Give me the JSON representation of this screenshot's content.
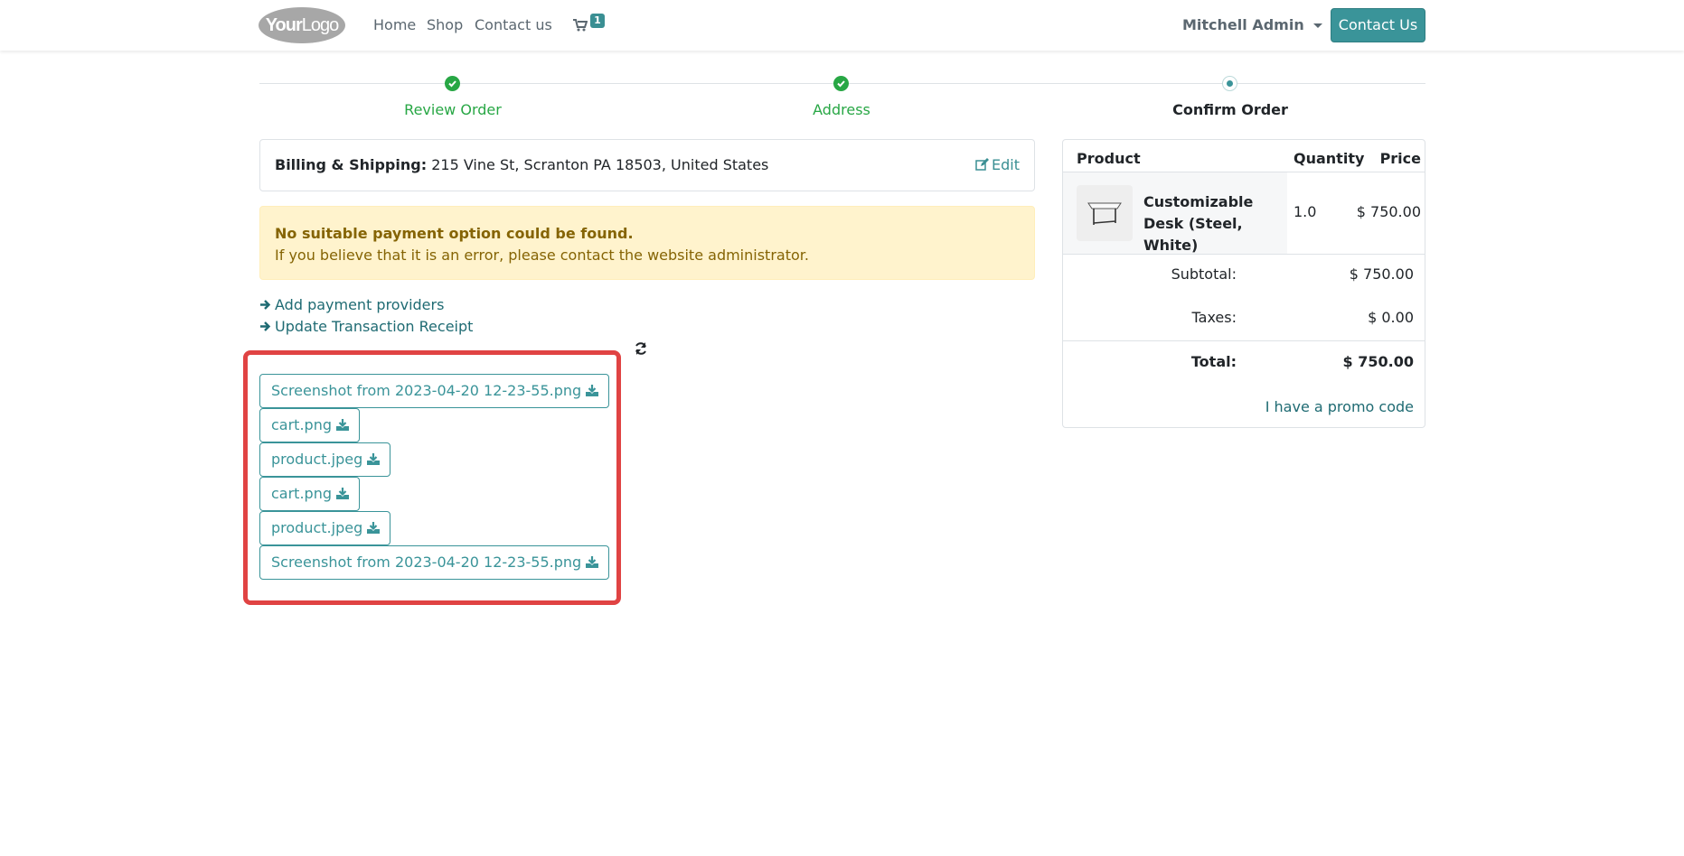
{
  "header": {
    "logo_text_bold": "Your",
    "logo_text_light": "Logo",
    "nav": [
      {
        "label": "Home"
      },
      {
        "label": "Shop"
      },
      {
        "label": "Contact us"
      }
    ],
    "cart_count": "1",
    "user_name": "Mitchell Admin",
    "contact_button": "Contact Us"
  },
  "wizard": {
    "steps": [
      {
        "label": "Review Order",
        "state": "done"
      },
      {
        "label": "Address",
        "state": "done"
      },
      {
        "label": "Confirm Order",
        "state": "current"
      }
    ]
  },
  "billing": {
    "label": "Billing & Shipping:",
    "address": "215 Vine St, Scranton PA 18503, United States",
    "edit_label": "Edit"
  },
  "alert": {
    "title": "No suitable payment option could be found.",
    "body": "If you believe that it is an error, please contact the website administrator."
  },
  "links": {
    "add_providers": "Add payment providers",
    "update_receipt": "Update Transaction Receipt"
  },
  "attachments": [
    {
      "name": "Screenshot from 2023-04-20 12-23-55.png"
    },
    {
      "name": "cart.png"
    },
    {
      "name": "product.jpeg"
    },
    {
      "name": "cart.png"
    },
    {
      "name": "product.jpeg"
    },
    {
      "name": "Screenshot from 2023-04-20 12-23-55.png"
    }
  ],
  "summary": {
    "headers": {
      "product": "Product",
      "quantity": "Quantity",
      "price": "Price"
    },
    "items": [
      {
        "name": "Customizable Desk (Steel, White)",
        "quantity": "1.0",
        "price": "$ 750.00"
      }
    ],
    "subtotal_label": "Subtotal:",
    "subtotal": "$ 750.00",
    "taxes_label": "Taxes:",
    "taxes": "$ 0.00",
    "total_label": "Total:",
    "total": "$ 750.00",
    "promo_label": "I have a promo code"
  },
  "colors": {
    "accent": "#3a9499",
    "success": "#28a745",
    "warning_bg": "#fff3cd",
    "highlight": "#e04343"
  }
}
